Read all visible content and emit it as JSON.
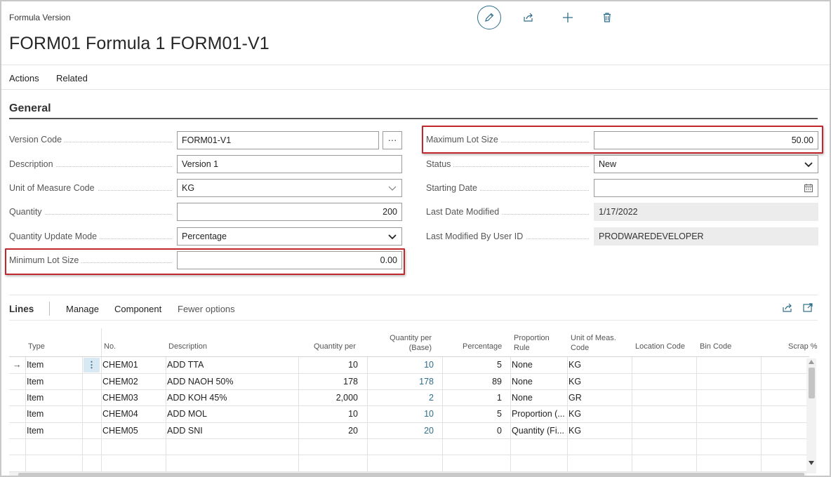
{
  "page": {
    "caption": "Formula Version",
    "title": "FORM01 Formula 1 FORM01-V1",
    "toolbar_icons": [
      "edit-icon",
      "share-icon",
      "add-icon",
      "delete-icon"
    ]
  },
  "menu": {
    "actions": "Actions",
    "related": "Related"
  },
  "general": {
    "title": "General",
    "left": {
      "version_code": {
        "label": "Version Code",
        "value": "FORM01-V1",
        "lookup": "···"
      },
      "description": {
        "label": "Description",
        "value": "Version 1"
      },
      "unit_of_measure_code": {
        "label": "Unit of Measure Code",
        "value": "KG"
      },
      "quantity": {
        "label": "Quantity",
        "value": "200"
      },
      "quantity_update_mode": {
        "label": "Quantity Update Mode",
        "value": "Percentage"
      },
      "minimum_lot_size": {
        "label": "Minimum Lot Size",
        "value": "0.00"
      }
    },
    "right": {
      "maximum_lot_size": {
        "label": "Maximum Lot Size",
        "value": "50.00"
      },
      "status": {
        "label": "Status",
        "value": "New"
      },
      "starting_date": {
        "label": "Starting Date",
        "value": ""
      },
      "last_date_modified": {
        "label": "Last Date Modified",
        "value": "1/17/2022"
      },
      "last_modified_by": {
        "label": "Last Modified By User ID",
        "value": "PRODWAREDEVELOPER"
      }
    }
  },
  "lines": {
    "title": "Lines",
    "menu": {
      "manage": "Manage",
      "component": "Component",
      "fewer": "Fewer options"
    },
    "headers": {
      "type": "Type",
      "no": "No.",
      "description": "Description",
      "quantity_per": "Quantity per",
      "quantity_per_base_1": "Quantity per",
      "quantity_per_base_2": "(Base)",
      "percentage": "Percentage",
      "proportion_1": "Proportion",
      "proportion_2": "Rule",
      "uom_1": "Unit of Meas.",
      "uom_2": "Code",
      "location": "Location Code",
      "bin": "Bin Code",
      "scrap": "Scrap %"
    },
    "row_arrow": "→",
    "row_menu": "⋮",
    "rows": [
      {
        "type": "Item",
        "no": "CHEM01",
        "description": "ADD TTA",
        "qty": "10",
        "qty_base": "10",
        "pct": "5",
        "rule": "None",
        "uom": "KG"
      },
      {
        "type": "Item",
        "no": "CHEM02",
        "description": "ADD NAOH 50%",
        "qty": "178",
        "qty_base": "178",
        "pct": "89",
        "rule": "None",
        "uom": "KG"
      },
      {
        "type": "Item",
        "no": "CHEM03",
        "description": "ADD KOH 45%",
        "qty": "2,000",
        "qty_base": "2",
        "pct": "1",
        "rule": "None",
        "uom": "GR"
      },
      {
        "type": "Item",
        "no": "CHEM04",
        "description": "ADD MOL",
        "qty": "10",
        "qty_base": "10",
        "pct": "5",
        "rule": "Proportion (...",
        "uom": "KG"
      },
      {
        "type": "Item",
        "no": "CHEM05",
        "description": "ADD SNI",
        "qty": "20",
        "qty_base": "20",
        "pct": "0",
        "rule": "Quantity (Fi...",
        "uom": "KG"
      }
    ]
  },
  "colors": {
    "accent": "#2f6e8c",
    "highlight": "#c0282d"
  }
}
